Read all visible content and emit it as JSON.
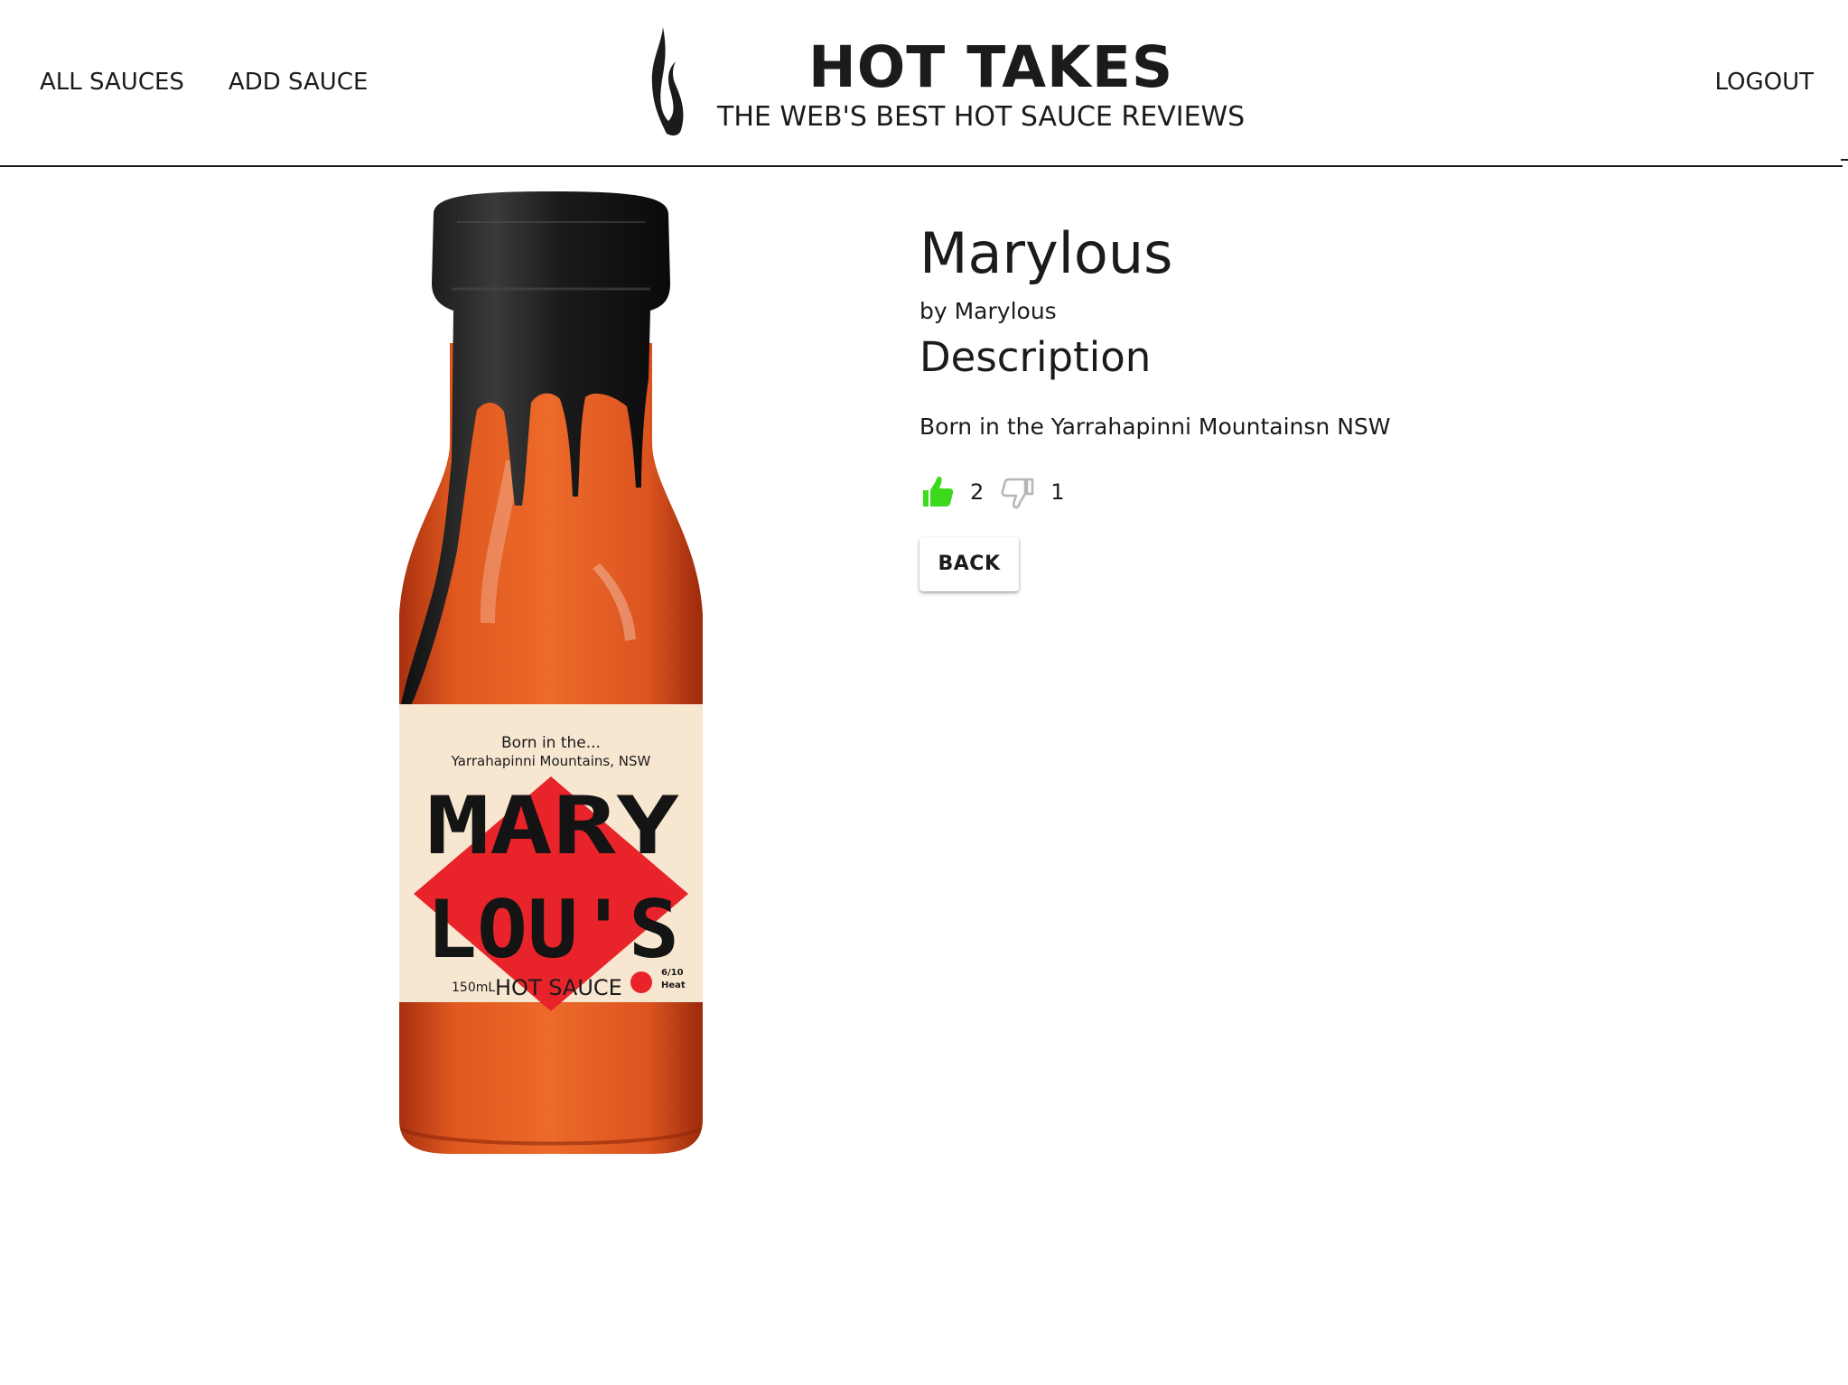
{
  "nav": {
    "all_sauces": "ALL SAUCES",
    "add_sauce": "ADD SAUCE",
    "logout": "LOGOUT"
  },
  "brand": {
    "title": "HOT TAKES",
    "subtitle": "THE WEB'S BEST HOT SAUCE REVIEWS",
    "icon": "flame-icon"
  },
  "sauce": {
    "name": "Marylous",
    "manufacturer": "by Marylous",
    "description_heading": "Description",
    "description": "Born in the Yarrahapinni Mountainsn NSW",
    "likes": "2",
    "dislikes": "1",
    "image": {
      "label_tagline_line1": "Born in the...",
      "label_tagline_line2": "Yarrahapinni Mountains, NSW",
      "label_brand_line1": "MARY",
      "label_brand_line2": "LOU'S",
      "label_volume": "150mL",
      "label_type": "HOT SAUCE",
      "label_heat_line1": "6/10",
      "label_heat_line2": "Heat"
    }
  },
  "actions": {
    "back": "BACK"
  },
  "colors": {
    "text": "#1b1b1b",
    "like_active": "#3dd91c",
    "dislike_inactive": "#b5b5b5",
    "sauce": "#d9511f",
    "label_bg": "#f7e6d0",
    "label_red": "#e8242a",
    "cap": "#1e1e1e"
  }
}
